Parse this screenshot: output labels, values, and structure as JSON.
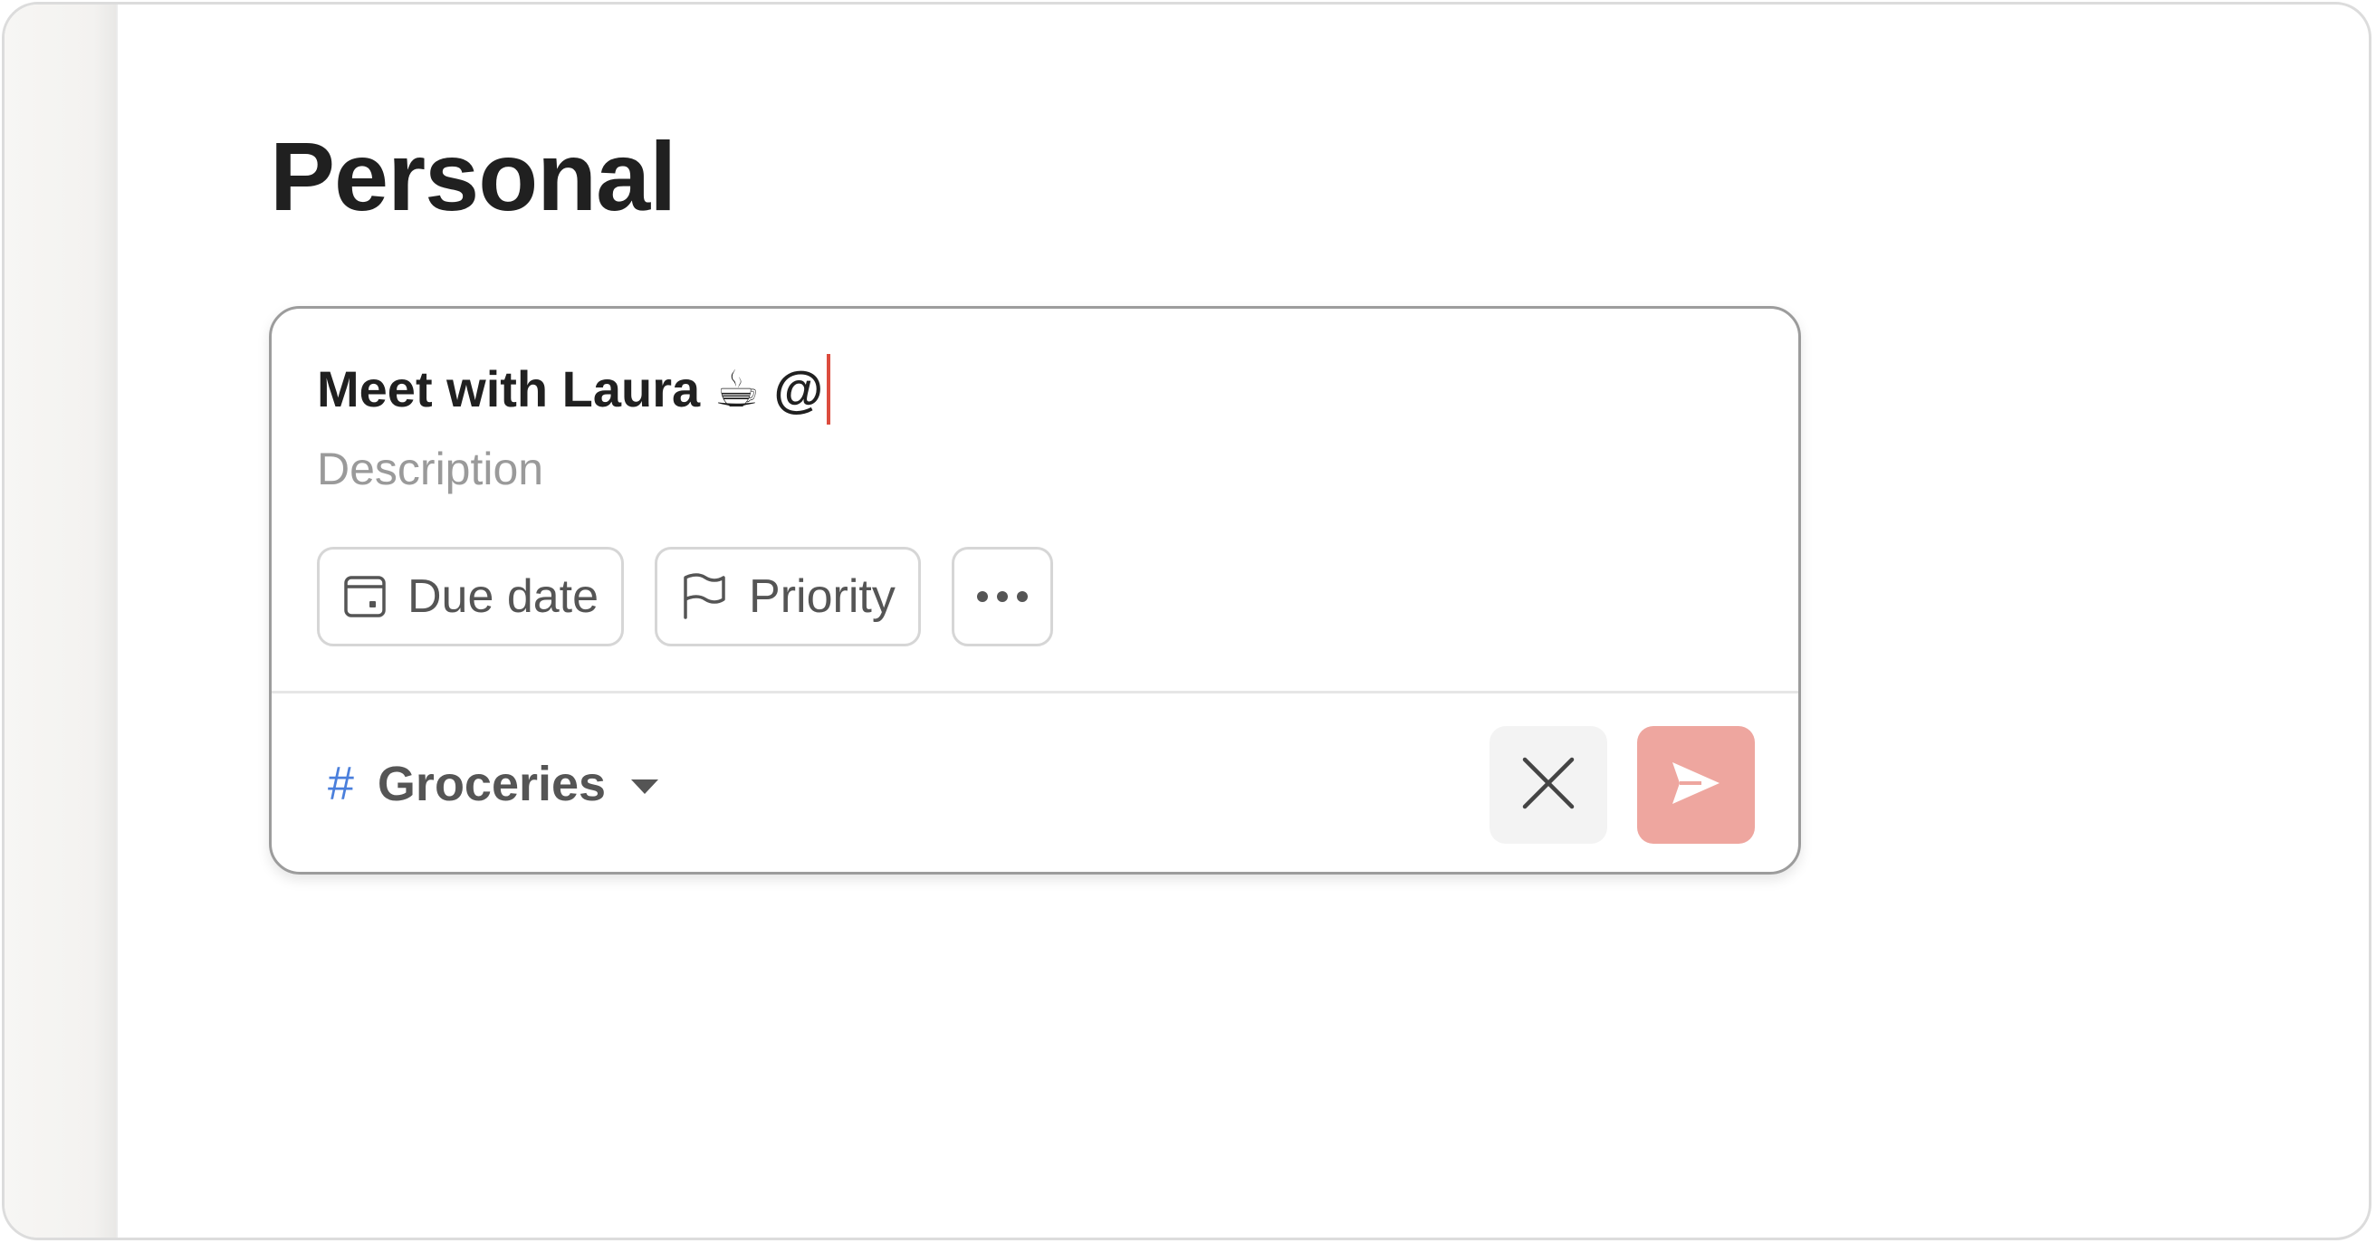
{
  "page": {
    "title": "Personal"
  },
  "composer": {
    "task_name": "Meet with Laura ☕ @",
    "description_placeholder": "Description",
    "chips": {
      "due_date": {
        "label": "Due date",
        "icon": "calendar-icon"
      },
      "priority": {
        "label": "Priority",
        "icon": "flag-icon"
      },
      "more": {
        "icon": "more-horizontal-icon"
      }
    },
    "project": {
      "hash": "#",
      "name": "Groceries"
    },
    "actions": {
      "cancel_icon": "close-icon",
      "submit_icon": "send-icon"
    },
    "colors": {
      "accent": "#dc4c3e",
      "submit_bg": "#eea69f",
      "project_hash": "#4a7fdc"
    }
  }
}
